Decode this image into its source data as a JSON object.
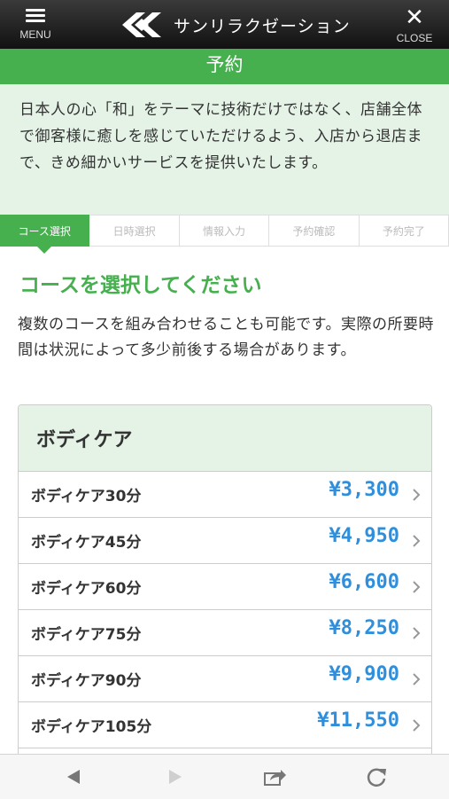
{
  "header": {
    "menu_label": "MENU",
    "close_label": "CLOSE",
    "logo_text": "サンリラクゼーション",
    "colors": {
      "bar": "#1a1a1a",
      "text": "#ffffff"
    }
  },
  "page_title": "予約",
  "intro_text": "日本人の心「和」をテーマに技術だけではなく、店舗全体で御客様に癒しを感じていただけるよう、入店から退店まで、きめ細かいサービスを提供いたします。",
  "steps": [
    {
      "label": "コース選択",
      "active": true
    },
    {
      "label": "日時選択",
      "active": false
    },
    {
      "label": "情報入力",
      "active": false
    },
    {
      "label": "予約確認",
      "active": false
    },
    {
      "label": "予約完了",
      "active": false
    }
  ],
  "section": {
    "title": "コースを選択してください",
    "description": "複数のコースを組み合わせることも可能です。実際の所要時間は状況によって多少前後する場合があります。"
  },
  "course_group": {
    "title": "ボディケア",
    "items": [
      {
        "name": "ボディケア30分",
        "price": "¥3,300"
      },
      {
        "name": "ボディケア45分",
        "price": "¥4,950"
      },
      {
        "name": "ボディケア60分",
        "price": "¥6,600"
      },
      {
        "name": "ボディケア75分",
        "price": "¥8,250"
      },
      {
        "name": "ボディケア90分",
        "price": "¥9,900"
      },
      {
        "name": "ボディケア105分",
        "price": "¥11,550"
      }
    ]
  },
  "browser_toolbar": {
    "icons": [
      "back-arrow-icon",
      "forward-arrow-icon",
      "share-icon",
      "reload-icon"
    ]
  },
  "colors": {
    "accent_green": "#46b04f",
    "light_green": "#e5f3e7",
    "price_blue": "#2f8fdd"
  }
}
